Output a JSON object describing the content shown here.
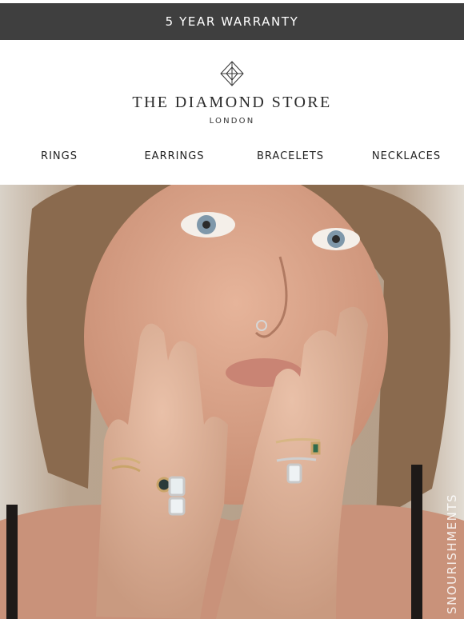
{
  "banner": {
    "text": "5 YEAR WARRANTY"
  },
  "brand": {
    "logo_icon": "diamond-icon",
    "name": "THE DIAMOND STORE",
    "location": "LONDON"
  },
  "nav": {
    "items": [
      {
        "label": "RINGS"
      },
      {
        "label": "EARRINGS"
      },
      {
        "label": "BRACELETS"
      },
      {
        "label": "NECKLACES"
      }
    ]
  },
  "hero": {
    "overlay_text": "SNOURISHMENTS"
  },
  "colors": {
    "banner_bg": "#3f3f3f",
    "text": "#222222"
  }
}
